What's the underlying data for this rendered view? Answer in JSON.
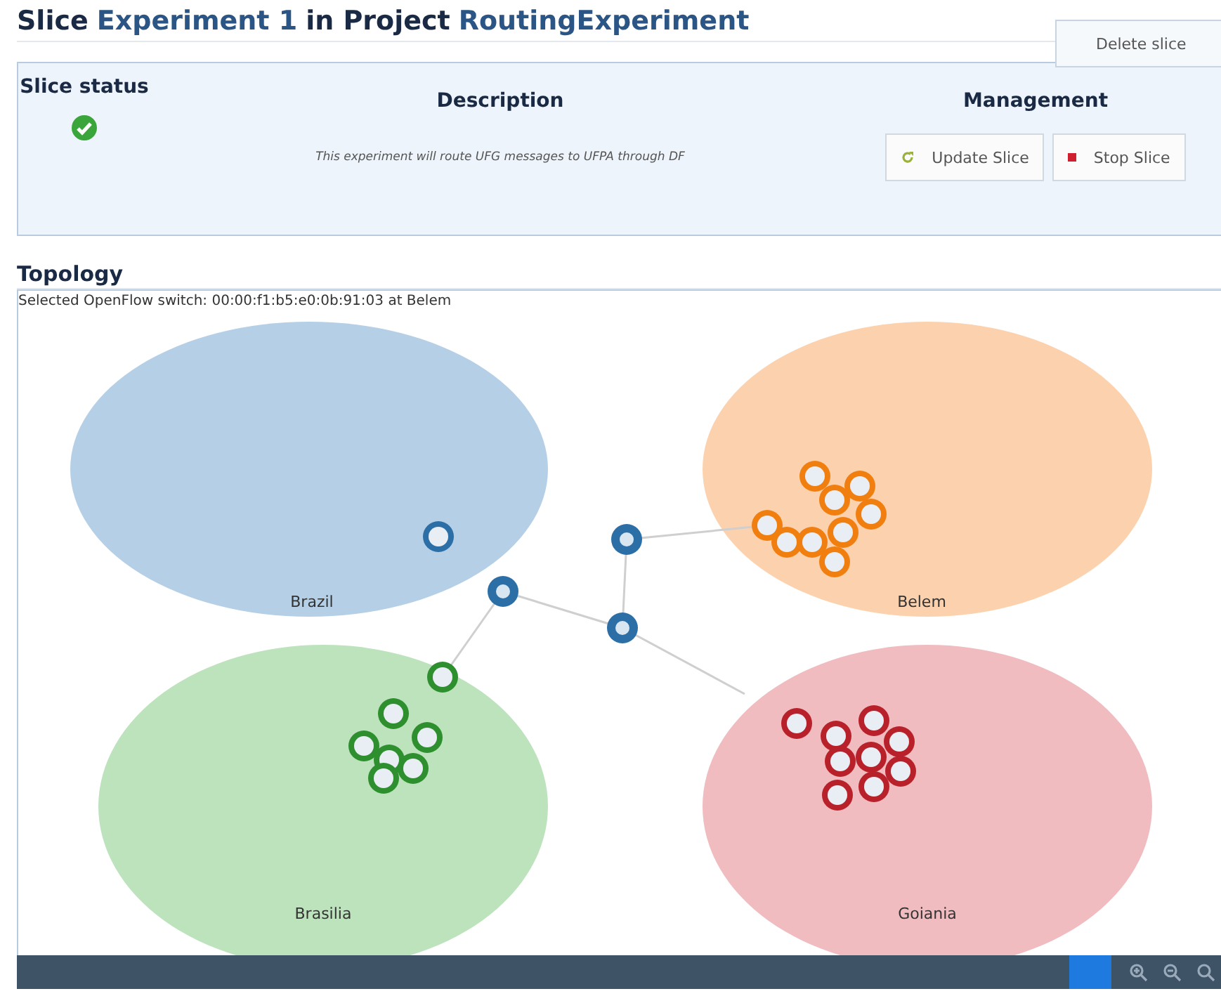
{
  "header": {
    "slice_word": "Slice",
    "slice_name": "Experiment 1",
    "project_word": "in Project",
    "project_name": "RoutingExperiment",
    "delete_button": "Delete slice"
  },
  "info_panel": {
    "columns": [
      "Slice status",
      "Description",
      "Management"
    ],
    "status_ok": true,
    "description": "This experiment will route UFG messages to UFPA through DF",
    "buttons": [
      {
        "label": "Update Slice",
        "kind": "update"
      },
      {
        "label": "Stop Slice",
        "kind": "stop"
      }
    ]
  },
  "topology": {
    "heading": "Topology",
    "status_line": "Selected OpenFlow switch: 00:00:f1:b5:e0:0b:91:03 at Belem",
    "regions": [
      {
        "label": "Brazil",
        "color": "#b5d0e6"
      },
      {
        "label": "Belem",
        "color": "#fcd2ae"
      },
      {
        "label": "Brasilia",
        "color": "#bde3bd"
      },
      {
        "label": "Goiania",
        "color": "#f0bcc0"
      }
    ]
  }
}
